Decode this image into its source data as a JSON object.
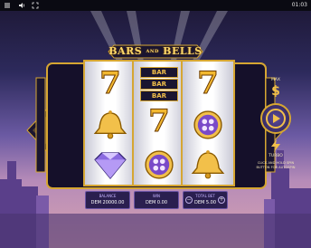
{
  "topbar": {
    "time": "01:03",
    "icons": [
      "menu-icon",
      "sound-icon",
      "fullscreen-icon"
    ]
  },
  "logo": {
    "part1": "BARS",
    "and": "AND",
    "part2": "BELLS"
  },
  "reels": [
    {
      "symbols": [
        "seven",
        "bell",
        "diamond"
      ]
    },
    {
      "symbols": [
        "bar-bar-bar",
        "seven",
        "clover-coin"
      ]
    },
    {
      "symbols": [
        "seven",
        "clover-coin",
        "bell"
      ]
    }
  ],
  "bar_labels": [
    "BAR",
    "BAR",
    "BAR"
  ],
  "seven_label": "7",
  "sidebar": {
    "max_label": "MAX",
    "currency_symbol": "$",
    "turbo_label": "TURBO",
    "hint": "CLICK AND HOLD SPIN BUTTON FOR AUTOSPIN"
  },
  "bottom": {
    "balance": {
      "label": "BALANCE",
      "value": "DEM 20000.00"
    },
    "win": {
      "label": "WIN",
      "value": "DEM 0.00"
    },
    "total_bet": {
      "label": "TOTAL BET",
      "value": "DEM 5.00"
    },
    "stepper_minus": "−",
    "stepper_plus": "+"
  },
  "colors": {
    "gold": "#d6a632",
    "panel": "#2a1f4f",
    "sky_top": "#2d2a5c",
    "sky_bottom": "#d7a3b0"
  }
}
